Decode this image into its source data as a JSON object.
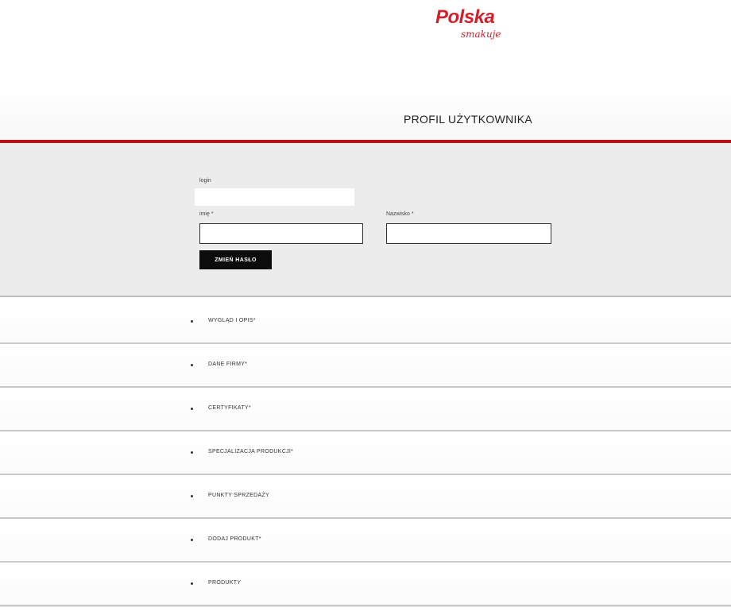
{
  "logo": {
    "main": "Polska",
    "sub": "smakuje"
  },
  "page": {
    "title": "PROFIL UŻYTKOWNIKA"
  },
  "form": {
    "login_label": "login",
    "first_name_label": "imię *",
    "first_name_value": "",
    "last_name_label": "Nazwisko *",
    "last_name_value": "",
    "change_password_label": "ZMIEŃ HASŁO"
  },
  "sections": [
    {
      "label": "WYGLĄD I OPIS*"
    },
    {
      "label": "DANE FIRMY*"
    },
    {
      "label": "CERTYFIKATY*"
    },
    {
      "label": "SPECJALIZACJA PRODUKCJI*"
    },
    {
      "label": "PUNKTY SPRZEDAŻY"
    },
    {
      "label": "DODAJ PRODUKT*"
    },
    {
      "label": "PRODUKTY"
    }
  ],
  "colors": {
    "brand_red": "#d1202a",
    "rule_red": "#b5121b",
    "button_black": "#0c0c0c",
    "panel_gray": "#ececec"
  }
}
